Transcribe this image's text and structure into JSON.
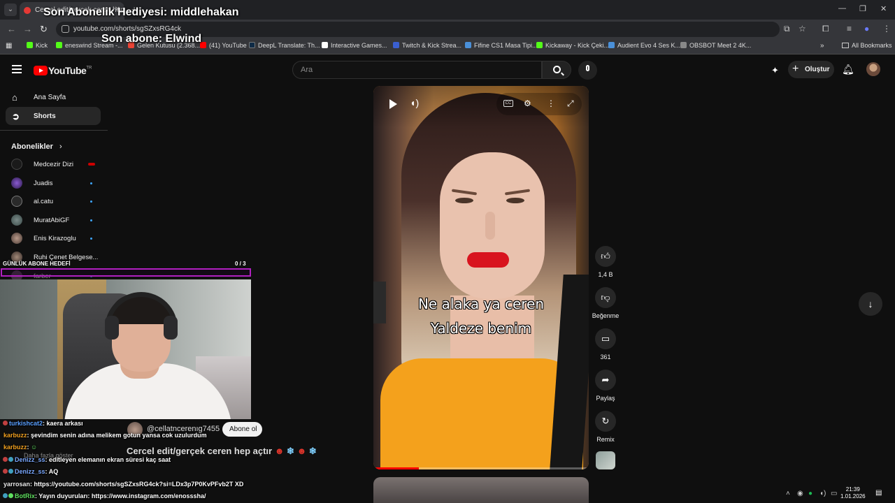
{
  "browser": {
    "tab_title": "Cercel edit/gerçek ceren hep",
    "address": "youtube.com/shorts/sgSZxsRG4ck",
    "bookmarks": [
      {
        "label": "Kick",
        "color": "#53fc18"
      },
      {
        "label": "eneswind Stream -...",
        "color": "#53fc18"
      },
      {
        "label": "Gelen Kutusu (2.368...",
        "color": "#ea4335"
      },
      {
        "label": "(41) YouTube",
        "color": "#ff0000"
      },
      {
        "label": "DeepL Translate: Th...",
        "color": "#0f2b46"
      },
      {
        "label": "Interactive Games...",
        "color": "#ffffff"
      },
      {
        "label": "Twitch & Kick Strea...",
        "color": "#3a5fd0"
      },
      {
        "label": "Fifine CS1 Masa Tipi...",
        "color": "#4a90d9"
      },
      {
        "label": "Kickaway - Kick Çeki...",
        "color": "#53fc18"
      },
      {
        "label": "Audient Evo 4 Ses K...",
        "color": "#4a90d9"
      },
      {
        "label": "OBSBOT Meet 2 4K...",
        "color": "#888888"
      }
    ],
    "all_bookmarks": "All Bookmarks"
  },
  "overlay": {
    "gift_text": "Son Abonelik Hediyesi: middlehakan",
    "last_sub_text": "Son abone: Elwind",
    "goal_label": "GÜNLÜK ABONE HEDEFİ",
    "goal_count": "0  / 3",
    "goal_progress": 0
  },
  "youtube": {
    "search_placeholder": "Ara",
    "create_label": "Oluştur",
    "logo_text": "YouTube",
    "logo_region": "TR",
    "sidebar": {
      "items": [
        {
          "label": "Ana Sayfa"
        },
        {
          "label": "Shorts"
        }
      ],
      "subs_heading": "Abonelikler",
      "subscriptions": [
        {
          "name": "Medcezir Dizi",
          "status": "live"
        },
        {
          "name": "Juadis",
          "status": "new"
        },
        {
          "name": "al.catu",
          "status": "new"
        },
        {
          "name": "MuratAbiGF",
          "status": "new"
        },
        {
          "name": "Enis Kirazoglu",
          "status": "new"
        },
        {
          "name": "Ruhi Çenet Belgese...",
          "status": "none"
        },
        {
          "name": "farber",
          "status": "new"
        }
      ]
    },
    "short": {
      "caption_line1": "Ne alaka ya ceren",
      "caption_line2": "Yaldeze benim",
      "channel": "@cellatncerenıg7455",
      "subscribe_label": "Abone ol",
      "title": "Cercel edit/gerçek ceren hep açtır",
      "more_label": "Daha fazla göster",
      "progress": 0.21
    },
    "actions": {
      "like_count": "1,4 B",
      "dislike_label": "Beğenme",
      "comment_count": "361",
      "share_label": "Paylaş",
      "remix_label": "Remix"
    }
  },
  "chat": [
    {
      "user": "turkishcat2",
      "message": ": kaera arkası",
      "color": "#5aa0ff"
    },
    {
      "user": "karbuzz",
      "message": ": şevindim senin adına melikem gotun yansa cok uzulurdum",
      "color": "#f0a020"
    },
    {
      "user": "karbuzz",
      "message": ": ",
      "color": "#f0a020"
    },
    {
      "user": "Denizz_ss",
      "message": ": editleyen elemanın ekran süresi kaç saat",
      "color": "#7aa8ff"
    },
    {
      "user": "Denizz_ss",
      "message": ": AQ",
      "color": "#7aa8ff"
    },
    {
      "user": "yarrosan",
      "message": ": https://youtube.com/shorts/sgSZxsRG4ck?si=LDx3p7P0KvPFvb2T XD",
      "color": "#e8e8e8"
    },
    {
      "user": "BotRix",
      "message": ": Yayın duyuruları: https://www.instagram.com/enosssha/",
      "color": "#60e060"
    }
  ],
  "tray": {
    "time": "21:39",
    "date": "1.01.2026"
  },
  "colors": {
    "accent": "#ff0000",
    "goal_border": "#b020c0",
    "bg": "#0f0f0f"
  }
}
